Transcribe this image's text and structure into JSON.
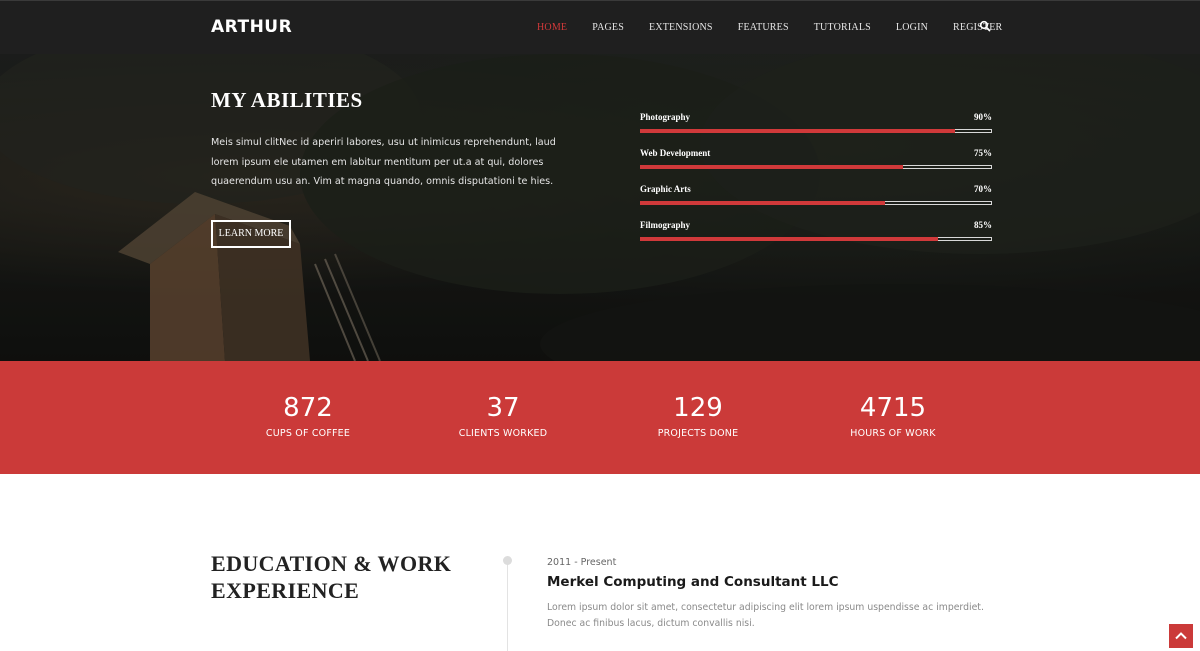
{
  "nav": {
    "logo": "ARTHUR",
    "items": [
      {
        "label": "HOME",
        "active": true
      },
      {
        "label": "PAGES"
      },
      {
        "label": "EXTENSIONS"
      },
      {
        "label": "FEATURES"
      },
      {
        "label": "TUTORIALS"
      },
      {
        "label": "LOGIN"
      },
      {
        "label": "REGISTER"
      }
    ],
    "search_icon": "search-icon"
  },
  "hero": {
    "title": "MY ABILITIES",
    "text": "Meis simul clitNec id aperiri labores, usu ut inimicus reprehendunt, laud lorem ipsum ele utamen em labitur mentitum per ut.a at qui, dolores quaerendum usu an. Vim at magna quando, omnis disputationi te hies.",
    "button_label": "LEARN MORE",
    "skills": [
      {
        "name": "Photography",
        "percent_label": "90%",
        "value": 90
      },
      {
        "name": "Web Development",
        "percent_label": "75%",
        "value": 75
      },
      {
        "name": "Graphic Arts",
        "percent_label": "70%",
        "value": 70
      },
      {
        "name": "Filmography",
        "percent_label": "85%",
        "value": 85
      }
    ]
  },
  "stats": [
    {
      "number": "872",
      "label": "CUPS OF COFFEE"
    },
    {
      "number": "37",
      "label": "CLIENTS WORKED"
    },
    {
      "number": "129",
      "label": "PROJECTS DONE"
    },
    {
      "number": "4715",
      "label": "HOURS OF WORK"
    }
  ],
  "education": {
    "title": "EDUCATION & WORK EXPERIENCE",
    "entries": [
      {
        "date": "2011 - Present",
        "company": "Merkel Computing and Consultant LLC",
        "description": "Lorem ipsum dolor sit amet, consectetur adipiscing elit lorem ipsum uspendisse ac imperdiet. Donec ac finibus lacus, dictum convallis nisi."
      }
    ]
  },
  "back_to_top_icon": "chevron-up-icon",
  "colors": {
    "accent": "#cb3a39",
    "nav_bg": "#1f1f1f",
    "nav_active": "#d0393a"
  }
}
